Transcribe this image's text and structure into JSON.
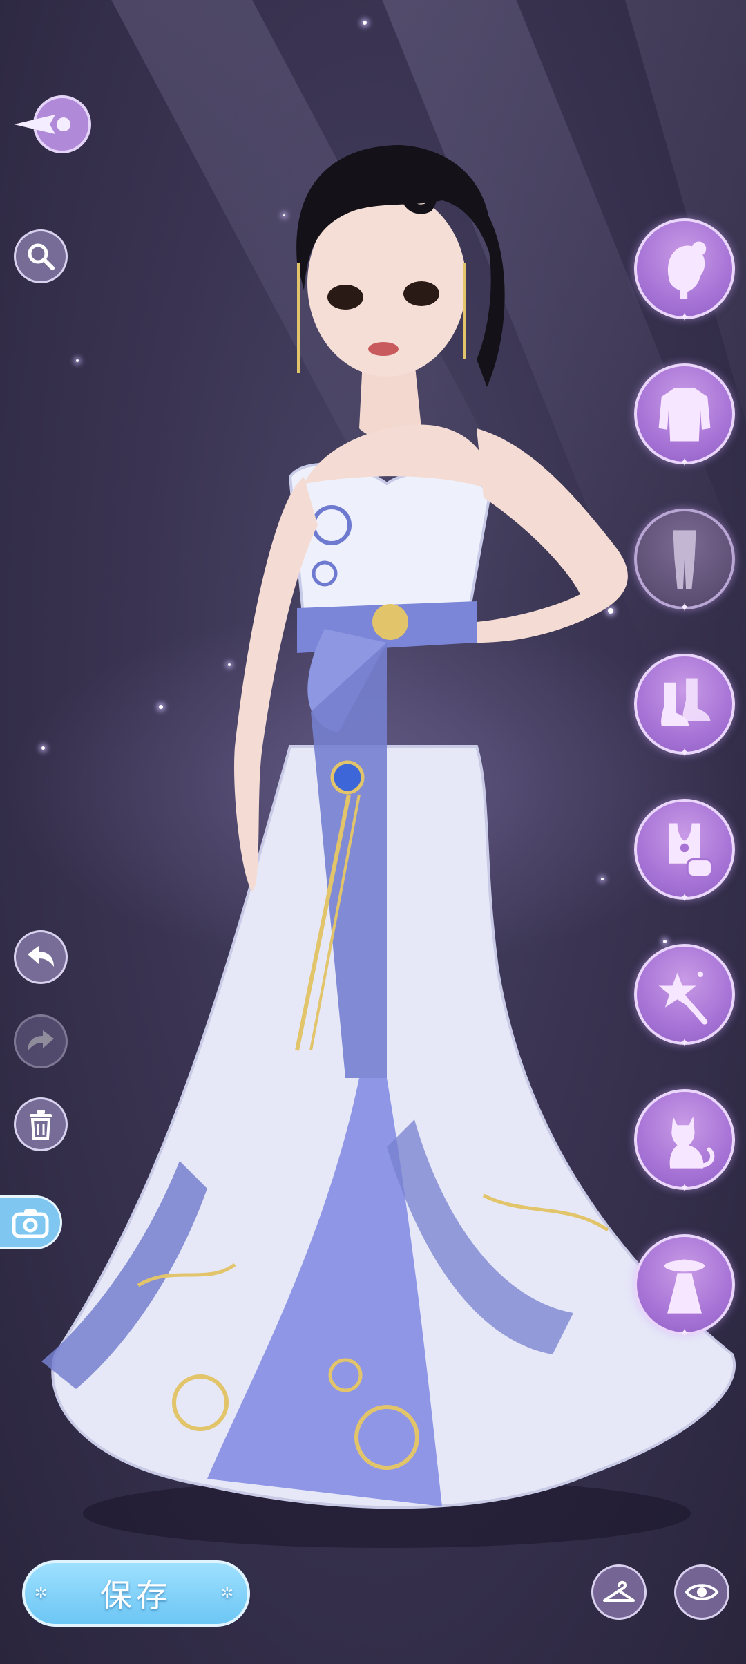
{
  "save_button": {
    "label": "保存"
  },
  "left_tools": [
    {
      "name": "search-icon"
    },
    {
      "name": "undo-icon"
    },
    {
      "name": "redo-icon"
    },
    {
      "name": "trash-icon"
    },
    {
      "name": "camera-icon"
    }
  ],
  "categories": [
    {
      "name": "hair-icon",
      "selected": false
    },
    {
      "name": "top-icon",
      "selected": false
    },
    {
      "name": "legwear-icon",
      "selected": true
    },
    {
      "name": "shoes-icon",
      "selected": false
    },
    {
      "name": "accessory-icon",
      "selected": false
    },
    {
      "name": "magic-wand-icon",
      "selected": false
    },
    {
      "name": "pet-cat-icon",
      "selected": false
    },
    {
      "name": "full-outfit-icon",
      "selected": false
    }
  ],
  "colors": {
    "background": "#3a3452",
    "category_button": "#a774d6",
    "category_selected": "#5e4f75",
    "save_button": "#6cc6f4",
    "gown": "#e4e6f6",
    "gown_accent": "#6f7fd6",
    "gold_trim": "#e2c46a"
  }
}
